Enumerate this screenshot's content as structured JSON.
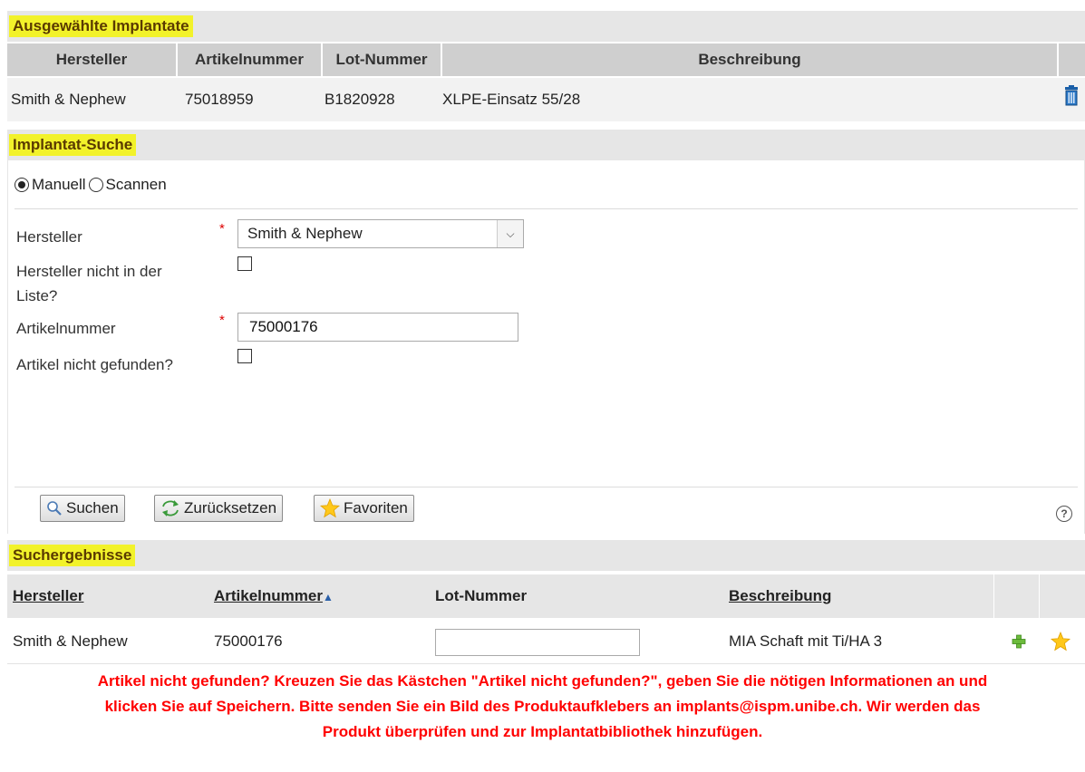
{
  "selected": {
    "title": "Ausgewählte Implantate",
    "columns": [
      "Hersteller",
      "Artikelnummer",
      "Lot-Nummer",
      "Beschreibung"
    ],
    "rows": [
      {
        "hersteller": "Smith & Nephew",
        "artikelnummer": "75018959",
        "lot": "B1820928",
        "beschreibung": "XLPE-Einsatz 55/28"
      }
    ]
  },
  "search": {
    "title": "Implantat-Suche",
    "mode_manual": "Manuell",
    "mode_scan": "Scannen",
    "hersteller_label": "Hersteller",
    "hersteller_value": "Smith & Nephew",
    "hersteller_missing_label_1": "Hersteller nicht in der",
    "hersteller_missing_label_2": "Liste?",
    "artikel_label": "Artikelnummer",
    "artikel_value": "75000176",
    "artikel_missing_label": "Artikel nicht gefunden?",
    "required_mark": "*",
    "btn_search": "Suchen",
    "btn_reset": "Zurücksetzen",
    "btn_favorites": "Favoriten",
    "help": "?"
  },
  "results": {
    "title": "Suchergebnisse",
    "columns": [
      "Hersteller",
      "Artikelnummer",
      "Lot-Nummer",
      "Beschreibung"
    ],
    "sort_indicator": "▲",
    "rows": [
      {
        "hersteller": "Smith & Nephew",
        "artikelnummer": "75000176",
        "beschreibung": "MIA Schaft mit Ti/HA 3"
      }
    ]
  },
  "notice": {
    "line1": "Artikel nicht gefunden? Kreuzen Sie das Kästchen \"Artikel nicht gefunden?\", geben Sie die nötigen Informationen an und",
    "line2": "klicken Sie auf Speichern. Bitte senden Sie ein Bild des Produktaufklebers an implants@ispm.unibe.ch. Wir werden das",
    "line3": "Produkt überprüfen und zur Implantatbibliothek hinzufügen."
  },
  "colors": {
    "highlight": "#f2f22a",
    "notice": "#ff0000",
    "header_bg": "#e6e6e6"
  }
}
